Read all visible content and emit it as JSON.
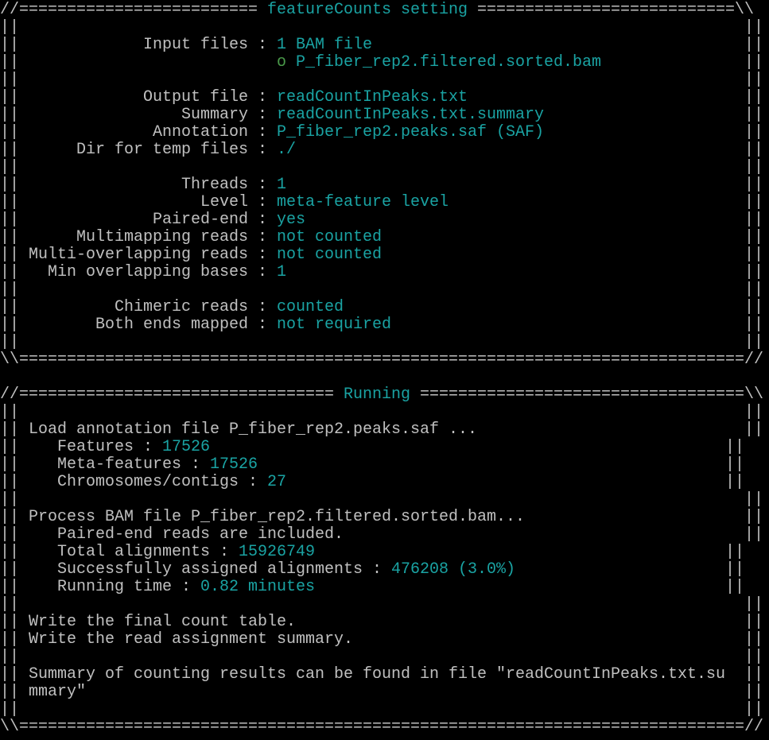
{
  "colors": {
    "background": "#000000",
    "text": "#c0c0c0",
    "value": "#1aa3a3",
    "bullet": "#4a9a4a"
  },
  "lines": [
    {
      "segs": [
        {
          "t": "//========================= "
        },
        {
          "t": "featureCounts setting",
          "c": "v"
        },
        {
          "t": " ===========================\\\\"
        }
      ]
    },
    {
      "segs": [
        {
          "t": "||                                                                            ||"
        }
      ]
    },
    {
      "segs": [
        {
          "t": "||             Input files : "
        },
        {
          "t": "1 BAM file",
          "c": "v"
        },
        {
          "t": "                                       ||"
        }
      ]
    },
    {
      "segs": [
        {
          "t": "||                           "
        },
        {
          "t": "o",
          "c": "g"
        },
        {
          "t": " "
        },
        {
          "t": "P_fiber_rep2.filtered.sorted.bam",
          "c": "v"
        },
        {
          "t": "               ||"
        }
      ]
    },
    {
      "segs": [
        {
          "t": "||                                                                            ||"
        }
      ]
    },
    {
      "segs": [
        {
          "t": "||             Output file : "
        },
        {
          "t": "readCountInPeaks.txt",
          "c": "v"
        },
        {
          "t": "                             ||"
        }
      ]
    },
    {
      "segs": [
        {
          "t": "||                 Summary : "
        },
        {
          "t": "readCountInPeaks.txt.summary",
          "c": "v"
        },
        {
          "t": "                     ||"
        }
      ]
    },
    {
      "segs": [
        {
          "t": "||              Annotation : "
        },
        {
          "t": "P_fiber_rep2.peaks.saf (SAF)",
          "c": "v"
        },
        {
          "t": "                     ||"
        }
      ]
    },
    {
      "segs": [
        {
          "t": "||      Dir for temp files : "
        },
        {
          "t": "./",
          "c": "v"
        },
        {
          "t": "                                               ||"
        }
      ]
    },
    {
      "segs": [
        {
          "t": "||                                                                            ||"
        }
      ]
    },
    {
      "segs": [
        {
          "t": "||                 Threads : "
        },
        {
          "t": "1",
          "c": "v"
        },
        {
          "t": "                                                ||"
        }
      ]
    },
    {
      "segs": [
        {
          "t": "||                   Level : "
        },
        {
          "t": "meta-feature level",
          "c": "v"
        },
        {
          "t": "                               ||"
        }
      ]
    },
    {
      "segs": [
        {
          "t": "||              Paired-end : "
        },
        {
          "t": "yes",
          "c": "v"
        },
        {
          "t": "                                              ||"
        }
      ]
    },
    {
      "segs": [
        {
          "t": "||      Multimapping reads : "
        },
        {
          "t": "not counted",
          "c": "v"
        },
        {
          "t": "                                      ||"
        }
      ]
    },
    {
      "segs": [
        {
          "t": "|| Multi-overlapping reads : "
        },
        {
          "t": "not counted",
          "c": "v"
        },
        {
          "t": "                                      ||"
        }
      ]
    },
    {
      "segs": [
        {
          "t": "||   Min overlapping bases : "
        },
        {
          "t": "1",
          "c": "v"
        },
        {
          "t": "                                                ||"
        }
      ]
    },
    {
      "segs": [
        {
          "t": "||                                                                            ||"
        }
      ]
    },
    {
      "segs": [
        {
          "t": "||          Chimeric reads : "
        },
        {
          "t": "counted",
          "c": "v"
        },
        {
          "t": "                                          ||"
        }
      ]
    },
    {
      "segs": [
        {
          "t": "||        Both ends mapped : "
        },
        {
          "t": "not required",
          "c": "v"
        },
        {
          "t": "                                     ||"
        }
      ]
    },
    {
      "segs": [
        {
          "t": "||                                                                            ||"
        }
      ]
    },
    {
      "segs": [
        {
          "t": "\\\\============================================================================//"
        }
      ]
    },
    {
      "segs": [
        {
          "t": ""
        }
      ]
    },
    {
      "segs": [
        {
          "t": "//================================= "
        },
        {
          "t": "Running",
          "c": "v"
        },
        {
          "t": " ==================================\\\\"
        }
      ]
    },
    {
      "segs": [
        {
          "t": "||                                                                            ||"
        }
      ]
    },
    {
      "segs": [
        {
          "t": "|| Load annotation file P_fiber_rep2.peaks.saf ...                            ||"
        }
      ]
    },
    {
      "segs": [
        {
          "t": "||    Features : "
        },
        {
          "t": "17526",
          "c": "v"
        },
        {
          "t": "                                                      ||"
        }
      ]
    },
    {
      "segs": [
        {
          "t": "||    Meta-features : "
        },
        {
          "t": "17526",
          "c": "v"
        },
        {
          "t": "                                                 ||"
        }
      ]
    },
    {
      "segs": [
        {
          "t": "||    Chromosomes/contigs : "
        },
        {
          "t": "27",
          "c": "v"
        },
        {
          "t": "                                              ||"
        }
      ]
    },
    {
      "segs": [
        {
          "t": "||                                                                            ||"
        }
      ]
    },
    {
      "segs": [
        {
          "t": "|| Process BAM file P_fiber_rep2.filtered.sorted.bam...                       ||"
        }
      ]
    },
    {
      "segs": [
        {
          "t": "||    Paired-end reads are included.                                          ||"
        }
      ]
    },
    {
      "segs": [
        {
          "t": "||    Total alignments : "
        },
        {
          "t": "15926749",
          "c": "v"
        },
        {
          "t": "                                           ||"
        }
      ]
    },
    {
      "segs": [
        {
          "t": "||    Successfully assigned alignments : "
        },
        {
          "t": "476208 (3.0%)",
          "c": "v"
        },
        {
          "t": "                      ||"
        }
      ]
    },
    {
      "segs": [
        {
          "t": "||    Running time : "
        },
        {
          "t": "0.82 minutes",
          "c": "v"
        },
        {
          "t": "                                           ||"
        }
      ]
    },
    {
      "segs": [
        {
          "t": "||                                                                            ||"
        }
      ]
    },
    {
      "segs": [
        {
          "t": "|| Write the final count table.                                               ||"
        }
      ]
    },
    {
      "segs": [
        {
          "t": "|| Write the read assignment summary.                                         ||"
        }
      ]
    },
    {
      "segs": [
        {
          "t": "||                                                                            ||"
        }
      ]
    },
    {
      "segs": [
        {
          "t": "|| Summary of counting results can be found in file \"readCountInPeaks.txt.su  ||"
        }
      ]
    },
    {
      "segs": [
        {
          "t": "|| mmary\"                                                                     ||"
        }
      ]
    },
    {
      "segs": [
        {
          "t": "||                                                                            ||"
        }
      ]
    },
    {
      "segs": [
        {
          "t": "\\\\============================================================================//"
        }
      ]
    }
  ]
}
